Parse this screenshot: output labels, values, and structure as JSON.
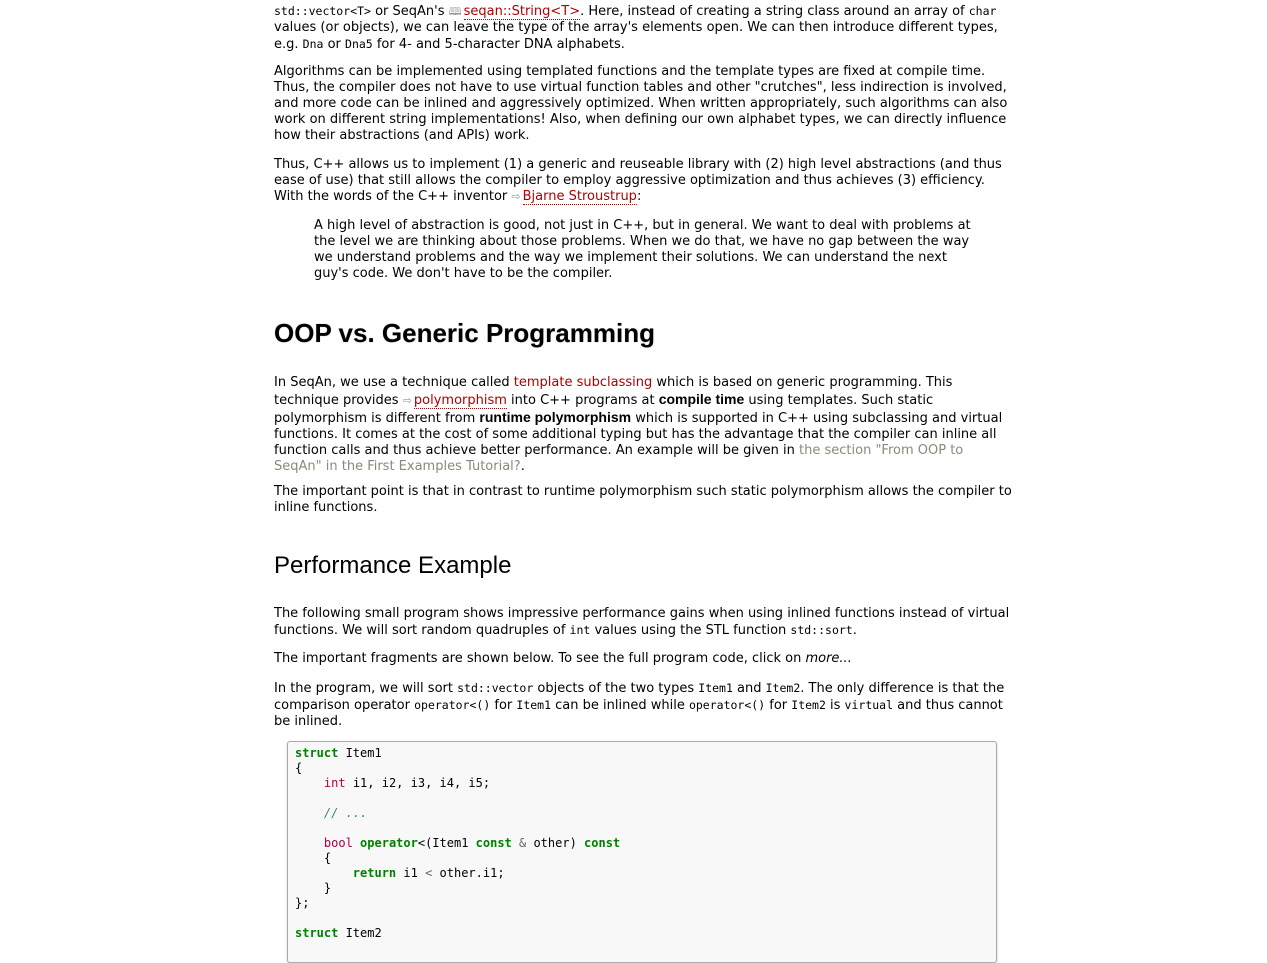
{
  "intro": {
    "p1_a": "std::vector<T>",
    "p1_b": " or SeqAn's ",
    "p1_link": "seqan::String<T>",
    "p1_c": ". Here, instead of creating a string class around an array of ",
    "p1_d": "char",
    "p1_e": " values (or objects), we can leave the type of the array's elements open. We can then introduce different types, e.g. ",
    "p1_f": "Dna",
    "p1_g": " or ",
    "p1_h": "Dna5",
    "p1_i": " for 4- and 5-character DNA alphabets.",
    "p2": "Algorithms can be implemented using templated functions and the template types are fixed at compile time. Thus, the compiler does not have to use virtual function tables and other \"crutches\", less indirection is involved, and more code can be inlined and aggressively optimized. When written appropriately, such algorithms can also work on different string implementations! Also, when defining our own alphabet types, we can directly influence how their abstractions (and APIs) work.",
    "p3_a": "Thus, C++ allows us to implement (1) a generic and reuseable library with (2) high level abstractions (and thus ease of use) that still allows the compiler to employ aggressive optimization and thus achieves (3) efficiency. With the words of the C++ inventor ",
    "p3_link": "Bjarne Stroustrup",
    "p3_b": ":",
    "quote": "A high level of abstraction is good, not just in C++, but in general. We want to deal with problems at the level we are thinking about those problems. When we do that, we have no gap between the way we understand problems and the way we implement their solutions. We can understand the next guy's code. We don't have to be the compiler."
  },
  "oop": {
    "heading": "OOP vs. Generic Programming",
    "p1_a": "In SeqAn, we use a technique called ",
    "p1_link1": "template subclassing",
    "p1_b": " which is based on generic programming. This technique provides ",
    "p1_link2": "polymorphism",
    "p1_c": " into C++ programs at ",
    "p1_bold1": "compile time",
    "p1_d": " using templates. Such static polymorphism is different from ",
    "p1_bold2": "runtime polymorphism",
    "p1_e": " which is supported in C++ using subclassing and virtual functions. It comes at the cost of some additional typing but has the advantage that the compiler can inline all function calls and thus achieve better performance. An example will be given in ",
    "p1_link3": "the section \"From OOP to SeqAn\" in the First Examples Tutorial?",
    "p1_f": ".",
    "p2": "The important point is that in contrast to runtime polymorphism such static polymorphism allows the compiler to inline functions."
  },
  "perf": {
    "heading": "Performance Example",
    "p1_a": "The following small program shows impressive performance gains when using inlined functions instead of virtual functions. We will sort random quadruples of ",
    "p1_b": "int",
    "p1_c": " values using the STL function ",
    "p1_d": "std::sort",
    "p1_e": ".",
    "p2_a": "The important fragments are shown below. To see the full program code, click on ",
    "p2_more": "more...",
    "p3_a": "In the program, we will sort ",
    "p3_b": "std::vector",
    "p3_c": " objects of the two types ",
    "p3_d": "Item1",
    "p3_e": " and ",
    "p3_f": "Item2",
    "p3_g": ". The only difference is that the comparison operator ",
    "p3_h": "operator<()",
    "p3_i": " for ",
    "p3_j": "Item1",
    "p3_k": " can be inlined while ",
    "p3_l": "operator<()",
    "p3_m": " for ",
    "p3_n": "Item2",
    "p3_o": " is ",
    "p3_p": "virtual",
    "p3_q": " and thus cannot be inlined."
  },
  "code": {
    "l1_kw": "struct",
    "l1_name": " Item1",
    "l2": "{",
    "l3_ty": "int",
    "l3_rest": " i1, i2, i3, i4, i5;",
    "l5_cm": "// ...",
    "l7_ty": "bool",
    "l7_kw": "operator",
    "l7_a": "<(Item1 ",
    "l7_kw2": "const",
    "l7_amp": " & ",
    "l7_b": "other) ",
    "l7_kw3": "const",
    "l8": "{",
    "l9_kw": "return",
    "l9_rest": " i1 ",
    "l9_op": "<",
    "l9_rest2": " other.i1;",
    "l10": "}",
    "l11": "};",
    "l13_kw": "struct",
    "l13_name": " Item2"
  }
}
